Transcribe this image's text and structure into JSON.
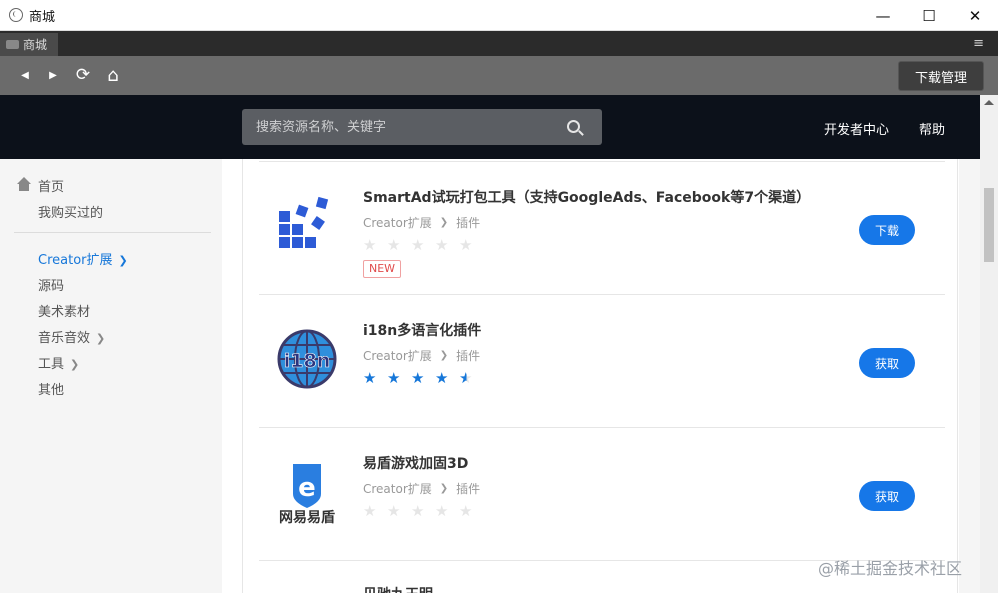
{
  "window": {
    "title": "商城",
    "min": "—",
    "max": "☐",
    "close": "✕"
  },
  "tabbar": {
    "tab_label": "商城",
    "menu": "≡"
  },
  "toolbar": {
    "back": "◀",
    "forward": "▶",
    "refresh": "⟳",
    "home": "⌂",
    "download_manager": "下载管理"
  },
  "header": {
    "search_placeholder": "搜索资源名称、关键字",
    "links": [
      "开发者中心",
      "帮助"
    ]
  },
  "sidebar": {
    "home": "首页",
    "purchased": "我购买过的",
    "categories": [
      {
        "label": "Creator扩展",
        "active": true,
        "has_children": true
      },
      {
        "label": "源码",
        "active": false,
        "has_children": false
      },
      {
        "label": "美术素材",
        "active": false,
        "has_children": false
      },
      {
        "label": "音乐音效",
        "active": false,
        "has_children": true
      },
      {
        "label": "工具",
        "active": false,
        "has_children": true
      },
      {
        "label": "其他",
        "active": false,
        "has_children": false
      }
    ]
  },
  "items": [
    {
      "name": "SmartAd试玩打包工具（支持GoogleAds、Facebook等7个渠道）",
      "category": "Creator扩展",
      "subcategory": "插件",
      "rating": 0,
      "badge": "NEW",
      "action": "下载"
    },
    {
      "name": "i18n多语言化插件",
      "category": "Creator扩展",
      "subcategory": "插件",
      "rating": 4.5,
      "action": "获取",
      "logo_text": "i18n"
    },
    {
      "name": "易盾游戏加固3D",
      "category": "Creator扩展",
      "subcategory": "插件",
      "rating": 0,
      "action": "获取",
      "logo_text": "网易易盾",
      "logo_letter": "e"
    }
  ],
  "partial_item_name": "贝驰九王明",
  "watermark": "@稀土掘金技术社区",
  "colors": {
    "accent": "#1677e8",
    "header_bg": "#0c111a",
    "toolbar_bg": "#6b6b6b"
  }
}
